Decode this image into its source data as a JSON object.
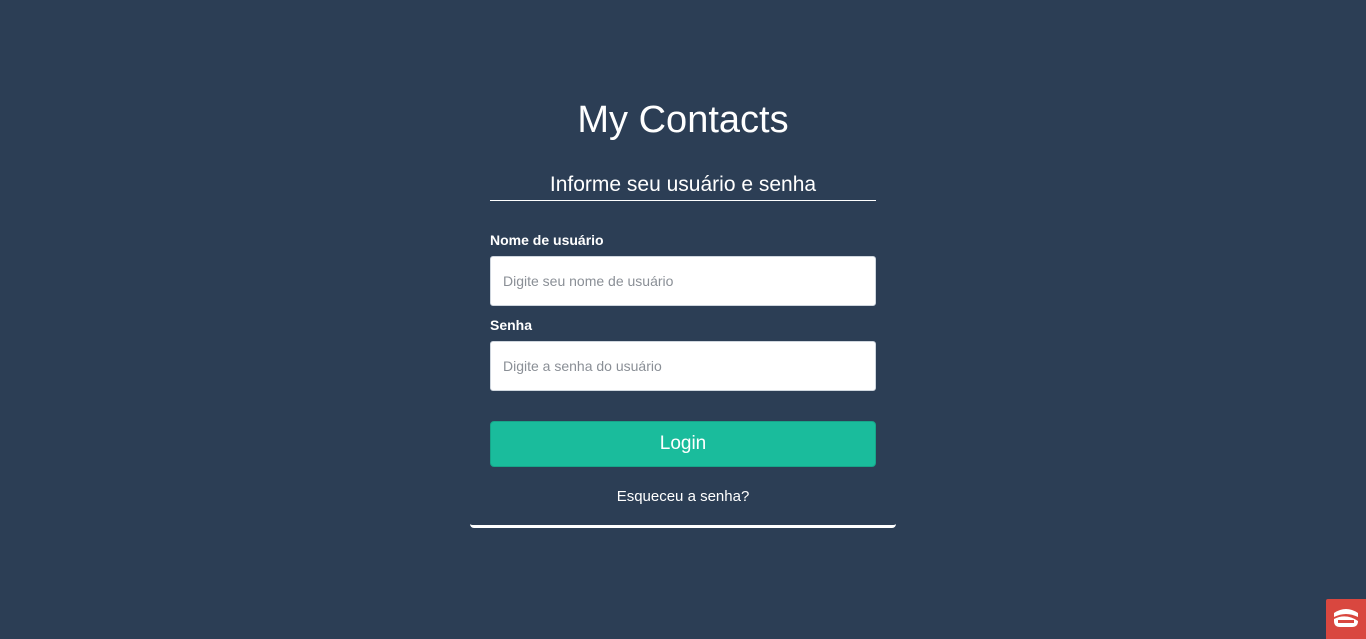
{
  "app": {
    "title": "My Contacts"
  },
  "login_form": {
    "heading": "Informe seu usuário e senha",
    "username_label": "Nome de usuário",
    "username_placeholder": "Digite seu nome de usuário",
    "username_value": "",
    "password_label": "Senha",
    "password_placeholder": "Digite a senha do usuário",
    "password_value": "",
    "login_button": "Login",
    "forgot_link": "Esqueceu a senha?"
  },
  "colors": {
    "background": "#2c3e55",
    "accent": "#1abc9c",
    "badge": "#d9473f"
  },
  "icons": {
    "corner_badge": "app-logo-icon"
  }
}
